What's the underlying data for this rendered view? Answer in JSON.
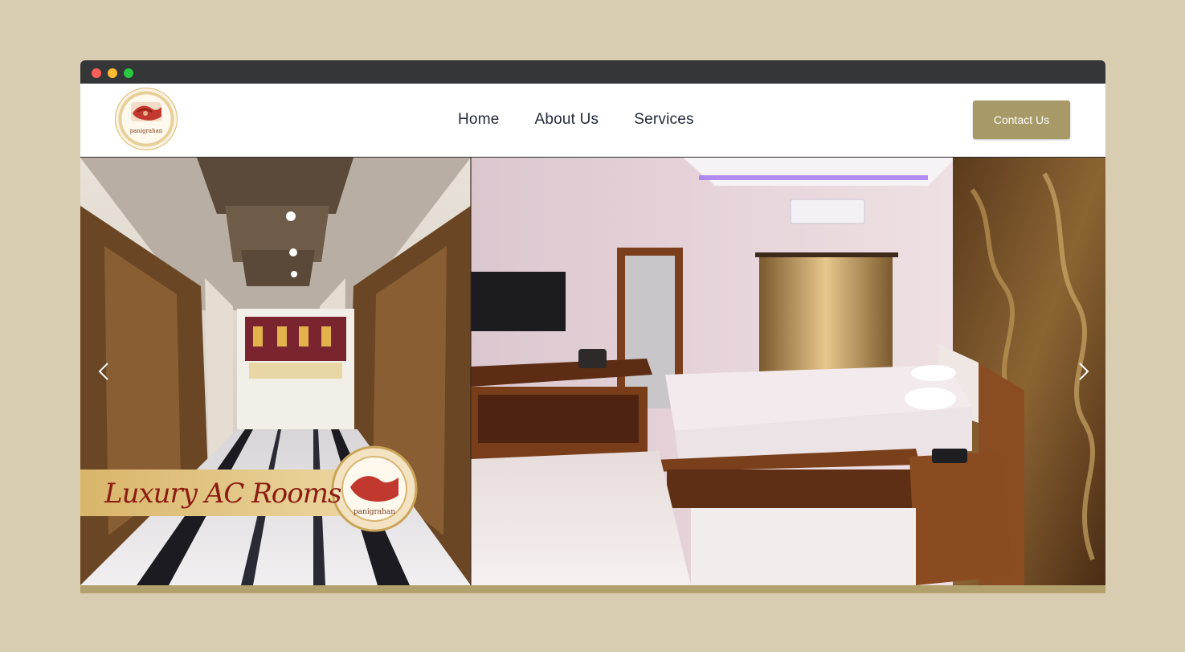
{
  "brand": {
    "logo_text": "panigrahan"
  },
  "nav": {
    "items": [
      {
        "label": "Home"
      },
      {
        "label": "About Us"
      },
      {
        "label": "Services"
      }
    ],
    "contact_label": "Contact Us"
  },
  "hero": {
    "banner_text": "Luxury AC Rooms",
    "badge_text": "panigrahan",
    "prev_icon": "chevron-left-icon",
    "next_icon": "chevron-right-icon"
  },
  "colors": {
    "page_bg": "#d8ccb1",
    "titlebar": "#353638",
    "accent_button": "#a79a67",
    "gold_bar": "#b3a16d",
    "nav_text": "#222a3a"
  }
}
